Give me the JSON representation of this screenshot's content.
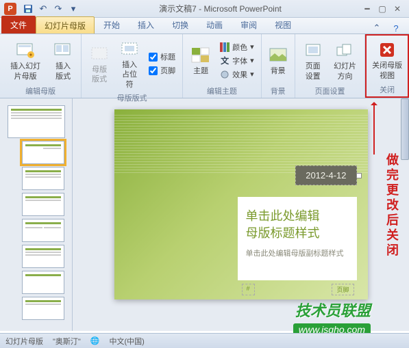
{
  "app_icon_letter": "P",
  "title": "演示文稿7 - Microsoft PowerPoint",
  "tabs": {
    "file": "文件",
    "master": "幻灯片母版",
    "home": "开始",
    "insert": "插入",
    "transitions": "切换",
    "animations": "动画",
    "review": "审阅",
    "view": "视图"
  },
  "ribbon": {
    "edit_master": {
      "label": "编辑母版",
      "insert_slide_master": "插入幻灯片母版",
      "insert_layout": "插入版式"
    },
    "master_layout": {
      "label": "母版版式",
      "master_format": "母版版式",
      "insert_placeholder": "插入占位符",
      "title_chk": "标题",
      "footer_chk": "页脚"
    },
    "edit_theme": {
      "label": "编辑主题",
      "theme": "主题",
      "colors": "颜色",
      "fonts": "字体",
      "effects": "效果"
    },
    "background": {
      "label": "背景",
      "background": "背景"
    },
    "page_setup": {
      "label": "页面设置",
      "page_setup": "页面设置",
      "slide_orientation": "幻灯片方向"
    },
    "close": {
      "label": "关闭",
      "close_master": "关闭母版视图"
    }
  },
  "slide": {
    "date": "2012-4-12",
    "title_line1": "单击此处编辑",
    "title_line2": "母版标题样式",
    "subtitle": "单击此处编辑母版副标题样式",
    "footer_left": "#",
    "footer_right": "页脚"
  },
  "annotation": "做完更改后关闭",
  "statusbar": {
    "view": "幻灯片母版",
    "theme": "\"奥斯汀\"",
    "lang": "中文(中国)"
  },
  "watermark": {
    "text": "技术员联盟",
    "url": "www.jsgho.com"
  }
}
